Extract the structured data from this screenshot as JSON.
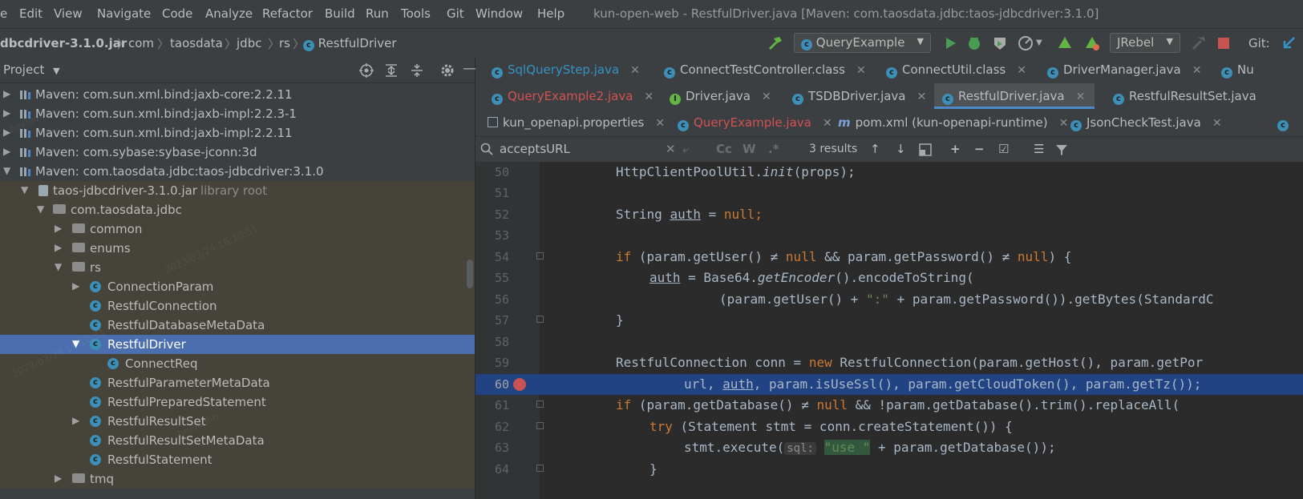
{
  "menubar": {
    "items": [
      "e",
      "Edit",
      "View",
      "Navigate",
      "Code",
      "Analyze",
      "Refactor",
      "Build",
      "Run",
      "Tools",
      "Git",
      "Window",
      "Help"
    ],
    "window_title": "kun-open-web - RestfulDriver.java [Maven: com.taosdata.jdbc:taos-jdbcdriver:3.1.0]"
  },
  "navbar": {
    "breadcrumbs": [
      "dbcdriver-3.1.0.jar",
      "com",
      "taosdata",
      "jdbc",
      "rs",
      "RestfulDriver"
    ],
    "run_config": "QueryExample",
    "jrebel": "JRebel",
    "git_label": "Git:"
  },
  "project_panel": {
    "title": "Project",
    "tree": [
      {
        "label": "Maven: com.sun.xml.bind:jaxb-core:2.2.11",
        "hint": ""
      },
      {
        "label": "Maven: com.sun.xml.bind:jaxb-impl:2.2.3-1",
        "hint": ""
      },
      {
        "label": "Maven: com.sun.xml.bind:jaxb-impl:2.2.11",
        "hint": ""
      },
      {
        "label": "Maven: com.sybase:sybase-jconn:3d",
        "hint": ""
      },
      {
        "label": "Maven: com.taosdata.jdbc:taos-jdbcdriver:3.1.0",
        "hint": ""
      },
      {
        "label": "taos-jdbcdriver-3.1.0.jar",
        "hint": "library root"
      },
      {
        "label": "com.taosdata.jdbc",
        "hint": ""
      },
      {
        "label": "common",
        "hint": ""
      },
      {
        "label": "enums",
        "hint": ""
      },
      {
        "label": "rs",
        "hint": ""
      },
      {
        "label": "ConnectionParam",
        "hint": ""
      },
      {
        "label": "RestfulConnection",
        "hint": ""
      },
      {
        "label": "RestfulDatabaseMetaData",
        "hint": ""
      },
      {
        "label": "RestfulDriver",
        "hint": ""
      },
      {
        "label": "ConnectReq",
        "hint": ""
      },
      {
        "label": "RestfulParameterMetaData",
        "hint": ""
      },
      {
        "label": "RestfulPreparedStatement",
        "hint": ""
      },
      {
        "label": "RestfulResultSet",
        "hint": ""
      },
      {
        "label": "RestfulResultSetMetaData",
        "hint": ""
      },
      {
        "label": "RestfulStatement",
        "hint": ""
      },
      {
        "label": "tmq",
        "hint": ""
      }
    ],
    "watermark_name": "hexiaolin",
    "watermark_date": "2023/03/24 16:10:51"
  },
  "tabs": {
    "row1": [
      "SqlQueryStep.java",
      "ConnectTestController.class",
      "ConnectUtil.class",
      "DriverManager.java",
      "Nu"
    ],
    "row2": [
      "QueryExample2.java",
      "Driver.java",
      "TSDBDriver.java",
      "RestfulDriver.java",
      "RestfulResultSet.java"
    ],
    "row3": [
      "kun_openapi.properties",
      "QueryExample.java",
      "pom.xml (kun-openapi-runtime)",
      "JsonCheckTest.java"
    ]
  },
  "search": {
    "query": "acceptsURL",
    "results": "3 results",
    "opt_cc": "Cc",
    "opt_w": "W",
    "opt_regex": ".*"
  },
  "editor": {
    "line_numbers": [
      "50",
      "51",
      "52",
      "53",
      "54",
      "55",
      "56",
      "57",
      "58",
      "59",
      "60",
      "61",
      "62",
      "63",
      "64"
    ],
    "l50_a": "HttpClientPoolUtil.",
    "l50_b": "init",
    "l50_c": "(props);",
    "l52_type": "String ",
    "l52_var": "auth",
    "l52_eq": " = ",
    "l52_null": "null",
    "l52_semi": ";",
    "l54_if": "if",
    "l54_a": " (param.getUser() ≠ ",
    "l54_null1": "null",
    "l54_b": " && param.getPassword() ≠ ",
    "l54_null2": "null",
    "l54_c": ") {",
    "l55_var": "auth",
    "l55_a": " = Base64.",
    "l55_b": "getEncoder",
    "l55_c": "().encodeToString(",
    "l56_a": "(param.getUser() + ",
    "l56_str": "\":\"",
    "l56_b": " + param.getPassword()).getBytes(StandardC",
    "l57": "}",
    "l59_a": "RestfulConnection conn = ",
    "l59_new": "new",
    "l59_b": " RestfulConnection(param.getHost(), param.getPor",
    "l60_a": "url, ",
    "l60_var": "auth",
    "l60_b": ", param.isUseSsl(), param.getCloudToken(), param.getTz());",
    "l61_if": "if",
    "l61_a": " (param.getDatabase() ≠ ",
    "l61_null": "null",
    "l61_b": " && !param.getDatabase().trim().replaceAll(",
    "l62_try": "try",
    "l62_a": " (Statement stmt = conn.createStatement()) {",
    "l63_a": "stmt.execute(",
    "l63_hint": "sql:",
    "l63_str": "\"use \"",
    "l63_b": " + param.getDatabase());",
    "l64": "}"
  }
}
